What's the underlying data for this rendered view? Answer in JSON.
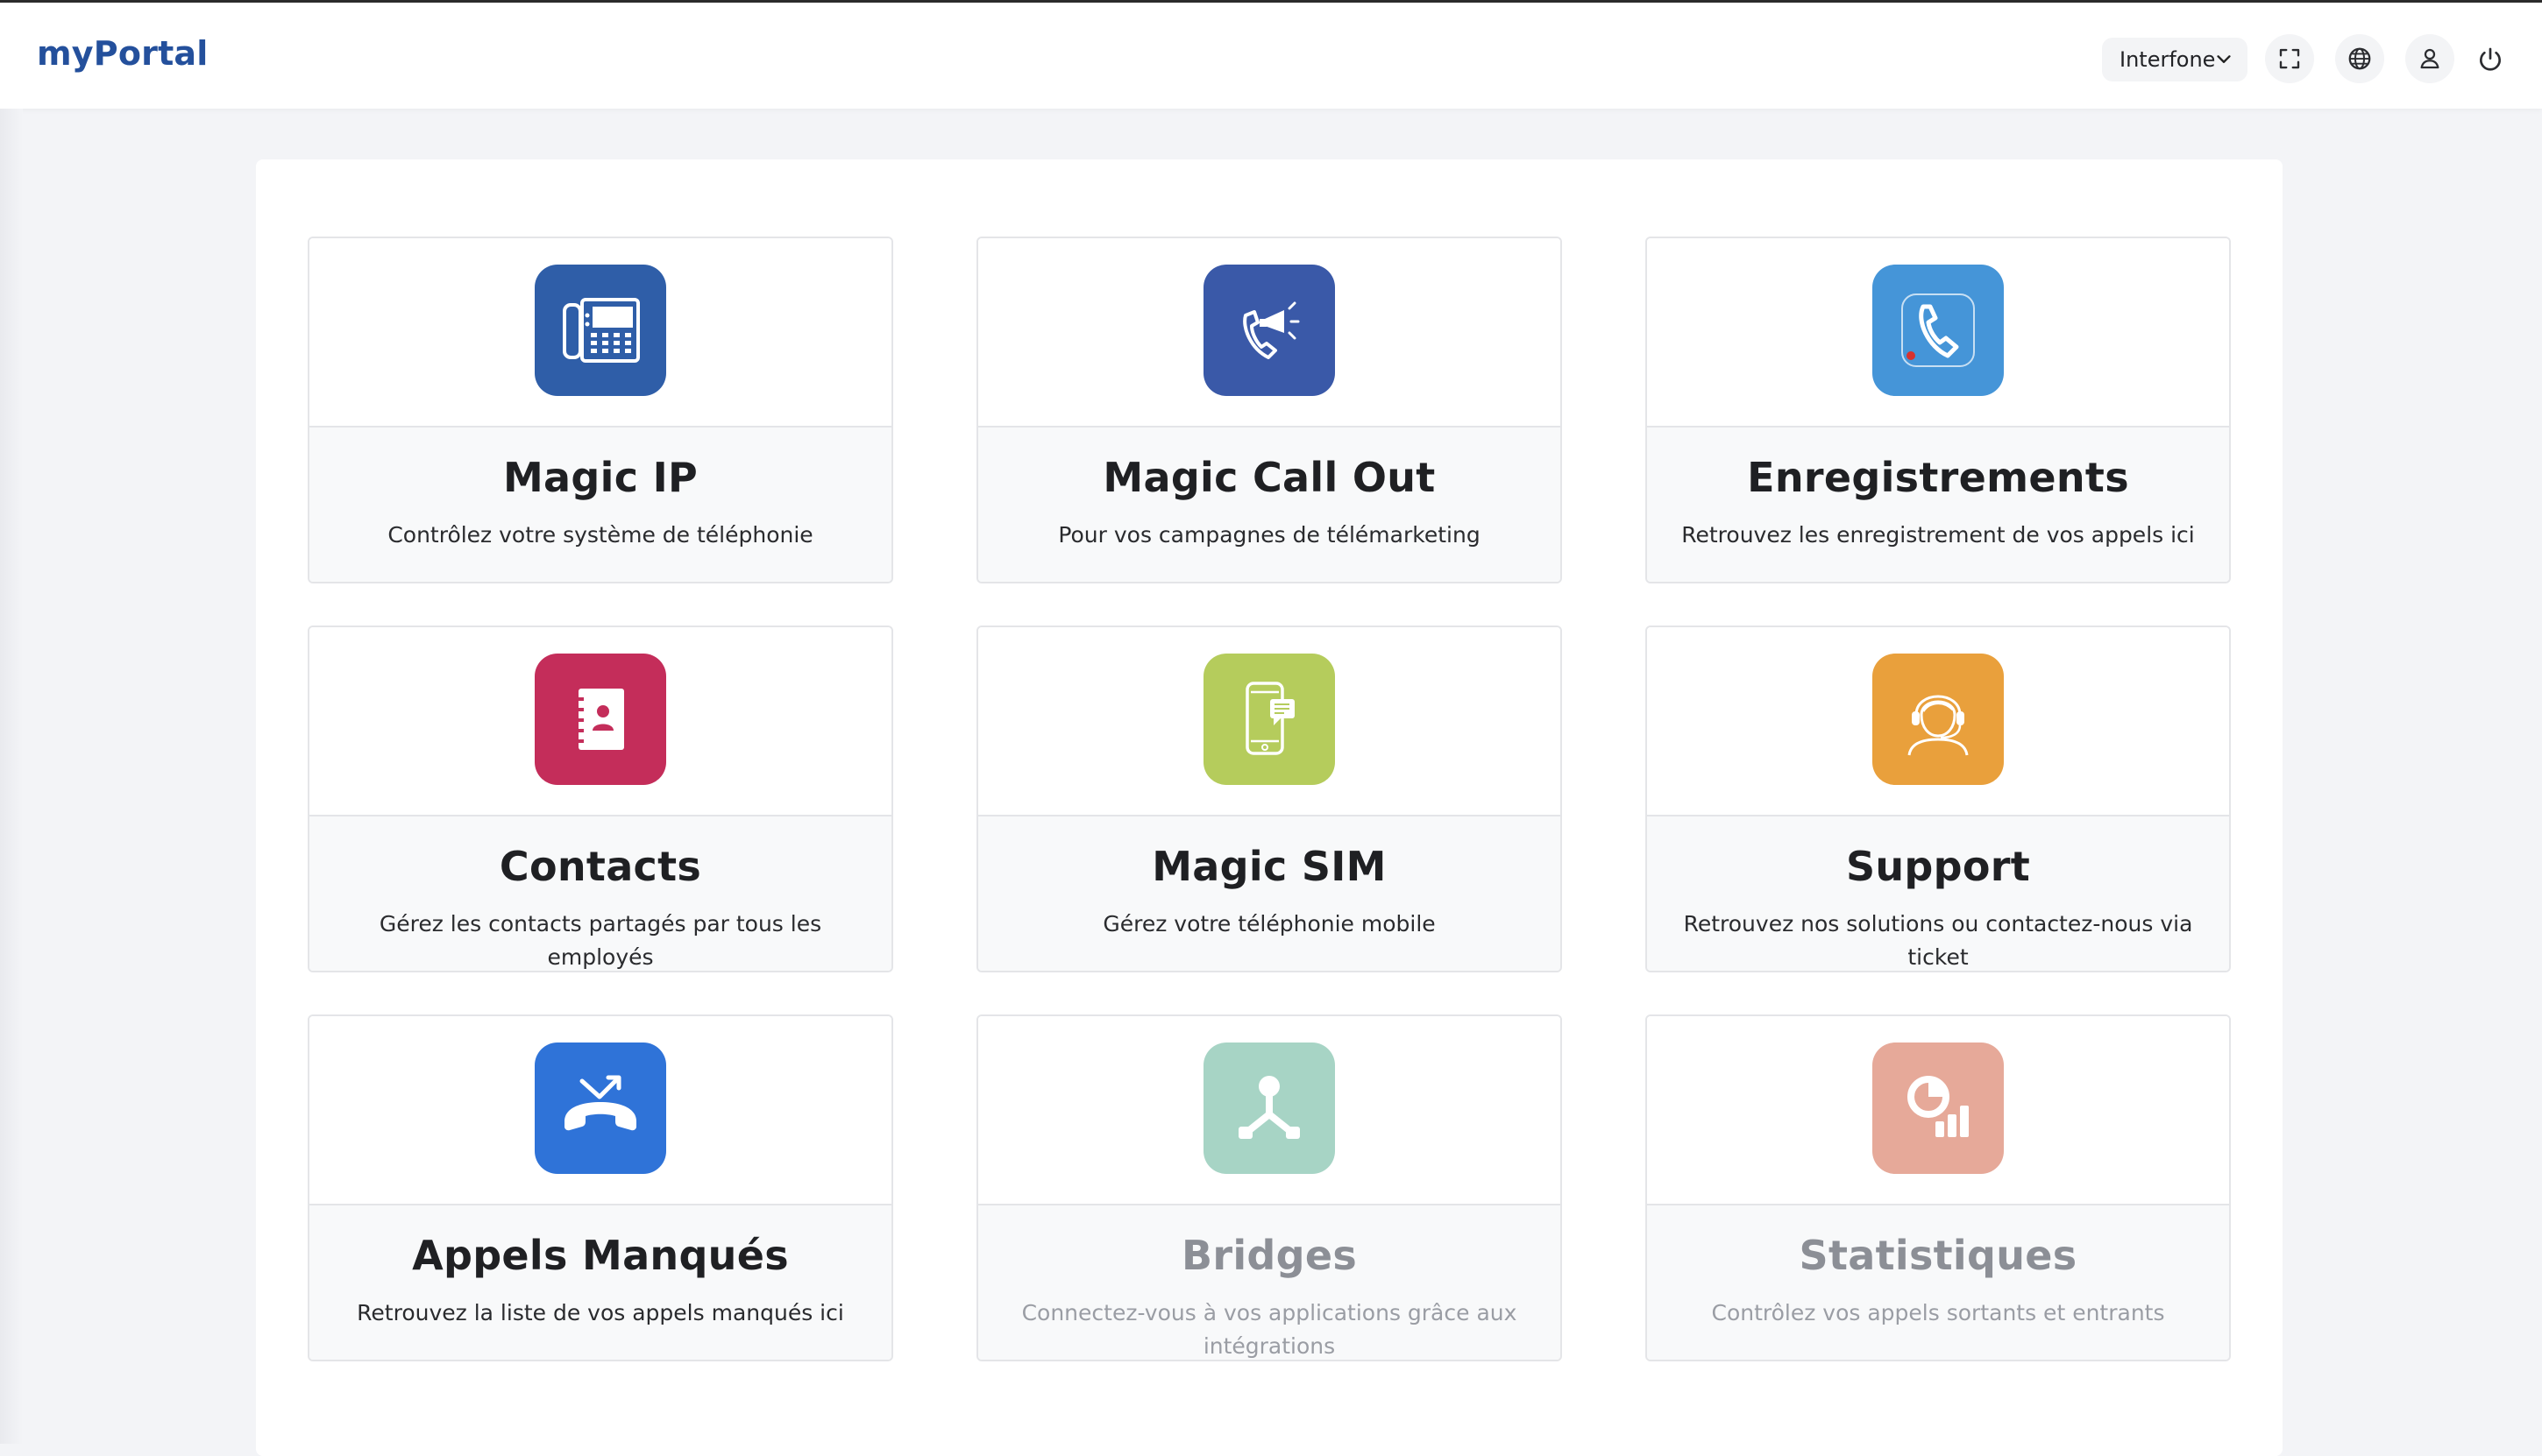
{
  "app": {
    "brand": "myPortal",
    "brand_color": "#24509c"
  },
  "header": {
    "select_value": "Interfone",
    "icons": [
      "fullscreen-icon",
      "globe-icon",
      "user-icon",
      "power-icon"
    ]
  },
  "cards": [
    {
      "id": "magic-ip",
      "title": "Magic IP",
      "desc": "Contrôlez votre système de téléphonie",
      "icon": "desk-phone-icon",
      "color": "#2f5ea8",
      "enabled": true
    },
    {
      "id": "magic-call-out",
      "title": "Magic Call Out",
      "desc": "Pour vos campagnes de télémarketing",
      "icon": "phone-megaphone-icon",
      "color": "#3a59a8",
      "enabled": true
    },
    {
      "id": "enregistrements",
      "title": "Enregistrements",
      "desc": "Retrouvez les enregistrement de vos appels ici",
      "icon": "phone-recording-icon",
      "color": "#4595d8",
      "enabled": true
    },
    {
      "id": "contacts",
      "title": "Contacts",
      "desc": "Gérez les contacts partagés par tous les employés",
      "icon": "address-book-icon",
      "color": "#c42d5a",
      "enabled": true
    },
    {
      "id": "magic-sim",
      "title": "Magic SIM",
      "desc": "Gérez votre téléphonie mobile",
      "icon": "mobile-phone-icon",
      "color": "#b5cc5c",
      "enabled": true
    },
    {
      "id": "support",
      "title": "Support",
      "desc": "Retrouvez nos solutions ou contactez-nous via ticket",
      "icon": "headset-agent-icon",
      "color": "#e9a03c",
      "enabled": true
    },
    {
      "id": "appels-manques",
      "title": "Appels Manqués",
      "desc": "Retrouvez la liste de vos appels manqués ici",
      "icon": "missed-call-icon",
      "color": "#2f73d8",
      "enabled": true
    },
    {
      "id": "bridges",
      "title": "Bridges",
      "desc": "Connectez-vous à vos applications grâce aux intégrations",
      "icon": "network-nodes-icon",
      "color": "#a7d4c5",
      "enabled": false
    },
    {
      "id": "statistiques",
      "title": "Statistiques",
      "desc": "Contrôlez vos appels sortants et entrants",
      "icon": "statistics-chart-icon",
      "color": "#e6a999",
      "enabled": false
    }
  ]
}
